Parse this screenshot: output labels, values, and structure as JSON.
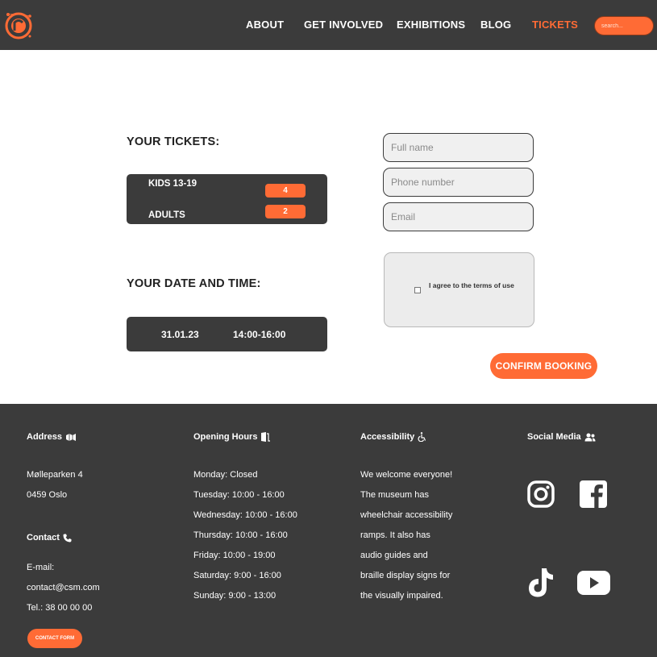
{
  "nav": {
    "items": [
      "ABOUT",
      "GET INVOLVED",
      "EXHIBITIONS",
      "BLOG",
      "TICKETS"
    ],
    "active": "TICKETS",
    "search_placeholder": "search..."
  },
  "tickets": {
    "title": "YOUR TICKETS:",
    "rows": [
      {
        "label": "KIDS 13-19",
        "qty": "4"
      },
      {
        "label": "ADULTS",
        "qty": "2"
      }
    ]
  },
  "datetime": {
    "title": "YOUR DATE AND TIME:",
    "date": "31.01.23",
    "time": "14:00-16:00"
  },
  "form": {
    "fullname_placeholder": "Full name",
    "phone_placeholder": "Phone number",
    "email_placeholder": "Email",
    "terms_label": "I agree to the terms of use",
    "confirm_label": "CONFIRM BOOKING"
  },
  "footer": {
    "address": {
      "title": "Address",
      "lines": [
        "Mølleparken 4",
        "0459 Oslo"
      ]
    },
    "contact": {
      "title": "Contact",
      "email_label": "E-mail:",
      "email": "contact@csm.com",
      "tel": "Tel.: 38 00 00 00",
      "button": "CONTACT FORM"
    },
    "hours": {
      "title": "Opening Hours",
      "lines": [
        "Monday: Closed",
        "Tuesday: 10:00 - 16:00",
        "Wednesday: 10:00 - 16:00",
        "Thursday: 10:00 - 16:00",
        "Friday: 10:00 - 19:00",
        "Saturday: 9:00 - 16:00",
        "Sunday: 9:00 - 13:00"
      ]
    },
    "accessibility": {
      "title": "Accessibility",
      "lines": [
        "We welcome everyone!",
        "The museum has",
        "wheelchair accessibility",
        "ramps. It also has",
        "audio guides and",
        "braille display signs for",
        "the visually impaired."
      ]
    },
    "social": {
      "title": "Social Media",
      "icons": [
        "instagram-icon",
        "facebook-icon",
        "tiktok-icon",
        "youtube-icon"
      ]
    }
  },
  "colors": {
    "accent": "#ff6b35",
    "dark": "#3b3b3b"
  }
}
